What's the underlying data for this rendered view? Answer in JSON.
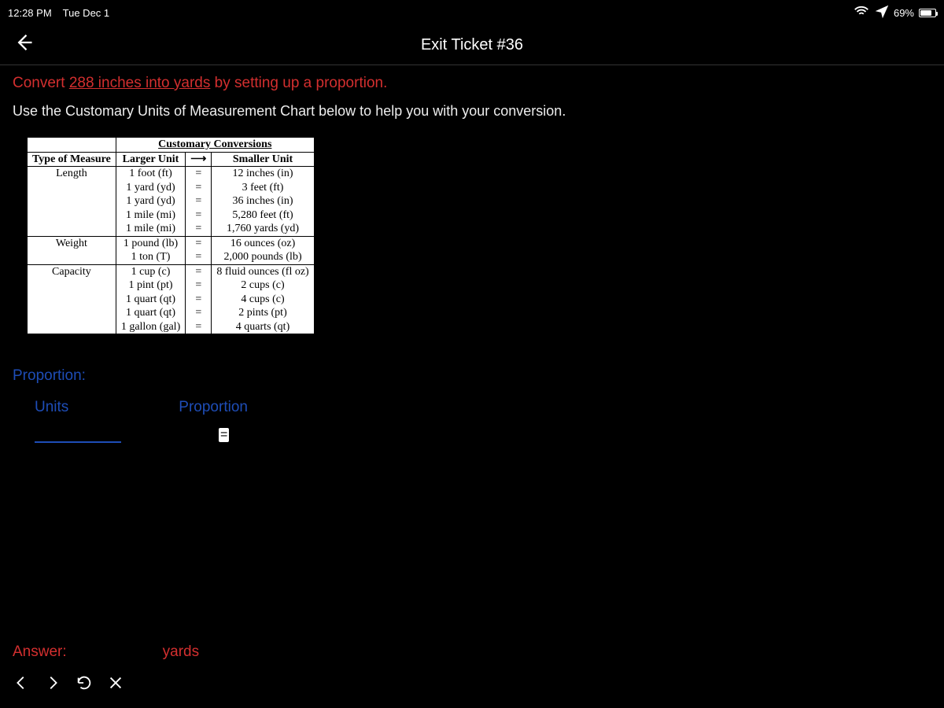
{
  "status": {
    "time": "12:28 PM",
    "date": "Tue Dec 1",
    "battery_pct": "69%"
  },
  "nav": {
    "title": "Exit Ticket #36"
  },
  "prompt": {
    "convert_word": "Convert",
    "amount_underlined": "288 inches into yards",
    "rest": " by setting up a proportion.",
    "line2": "Use the Customary Units of Measurement Chart below to help you with your conversion."
  },
  "chart": {
    "title": "Customary Conversions",
    "headers": {
      "type": "Type of Measure",
      "larger": "Larger Unit",
      "smaller": "Smaller Unit"
    },
    "rows": [
      {
        "type": "Length",
        "larger": "1 foot (ft)\n1 yard (yd)\n1 yard (yd)\n1 mile (mi)\n1 mile (mi)",
        "eq": "=\n=\n=\n=\n=",
        "smaller": "12 inches (in)\n3 feet (ft)\n36 inches (in)\n5,280 feet (ft)\n1,760 yards (yd)"
      },
      {
        "type": "Weight",
        "larger": "1 pound (lb)\n1 ton (T)",
        "eq": "=\n=",
        "smaller": "16 ounces (oz)\n2,000 pounds (lb)"
      },
      {
        "type": "Capacity",
        "larger": "1 cup (c)\n1 pint (pt)\n1 quart (qt)\n1 quart (qt)\n1 gallon (gal)",
        "eq": "=\n=\n=\n=\n=",
        "smaller": "8 fluid ounces (fl oz)\n2 cups (c)\n4 cups (c)\n2 pints (pt)\n4 quarts (qt)"
      }
    ]
  },
  "sections": {
    "proportion_label": "Proportion:",
    "units_label": "Units",
    "proportion_col": "Proportion",
    "eq": "="
  },
  "answer": {
    "label": "Answer:",
    "unit": "yards"
  }
}
